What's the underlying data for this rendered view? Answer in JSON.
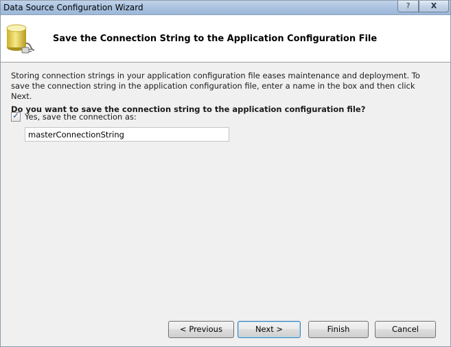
{
  "window": {
    "title": "Data Source Configuration Wizard",
    "help_glyph": "?",
    "close_glyph": "X"
  },
  "header": {
    "title": "Save the Connection String to the Application Configuration File",
    "icon": "database-connection-icon"
  },
  "content": {
    "description": "Storing connection strings in your application configuration file eases maintenance and deployment. To save the connection string in the application configuration file, enter a name in the box and then click Next.",
    "question": "Do you want to save the connection string to the application configuration file?",
    "save_checkbox": {
      "label": "Yes, save the connection as:",
      "checked": true
    },
    "connection_name": {
      "value": "masterConnectionString"
    }
  },
  "buttons": {
    "previous": "< Previous",
    "next": "Next >",
    "finish": "Finish",
    "cancel": "Cancel"
  }
}
